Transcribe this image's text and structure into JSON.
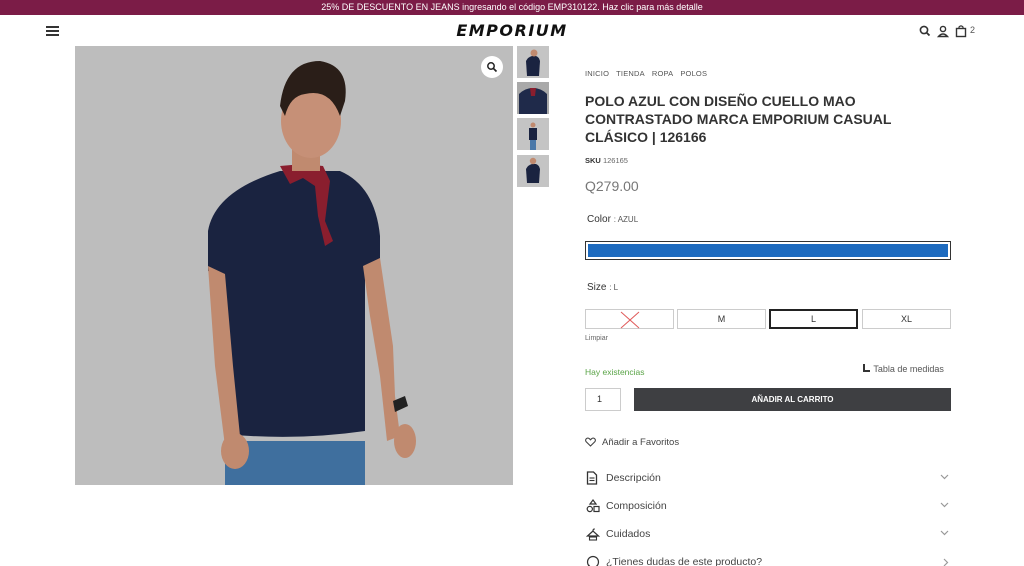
{
  "promo": {
    "text": "25% DE DESCUENTO EN JEANS ingresando el código EMP310122. Haz clic para más detalle"
  },
  "header": {
    "logo": "EMPORIUM",
    "cart_count": "2"
  },
  "breadcrumb": [
    "INICIO",
    "TIENDA",
    "ROPA",
    "POLOS"
  ],
  "product": {
    "title": "POLO AZUL CON DISEÑO CUELLO MAO CONTRASTADO MARCA EMPORIUM CASUAL CLÁSICO | 126166",
    "sku_label": "SKU",
    "sku_value": "126165",
    "price": "Q279.00",
    "color_label": "Color",
    "color_value": ": AZUL",
    "color_hex": "#1e6bbf",
    "size_label": "Size",
    "size_value": ": L",
    "sizes": [
      "",
      "M",
      "L",
      "XL"
    ],
    "selected_size": "L",
    "clear": "Limpiar",
    "stock": "Hay existencias",
    "size_guide": "Tabla de medidas",
    "quantity": "1",
    "add_to_cart": "AÑADIR AL CARRITO",
    "wishlist": "Añadir a Favoritos"
  },
  "accordions": [
    "Descripción",
    "Composición",
    "Cuidados",
    "¿Tienes dudas de este producto?"
  ],
  "colors": {
    "promo_bg": "#7b1c47",
    "button_bg": "#3e3f42",
    "stock_green": "#5aa447",
    "shirt_navy": "#1a2340",
    "collar_red": "#8a1e2e"
  }
}
